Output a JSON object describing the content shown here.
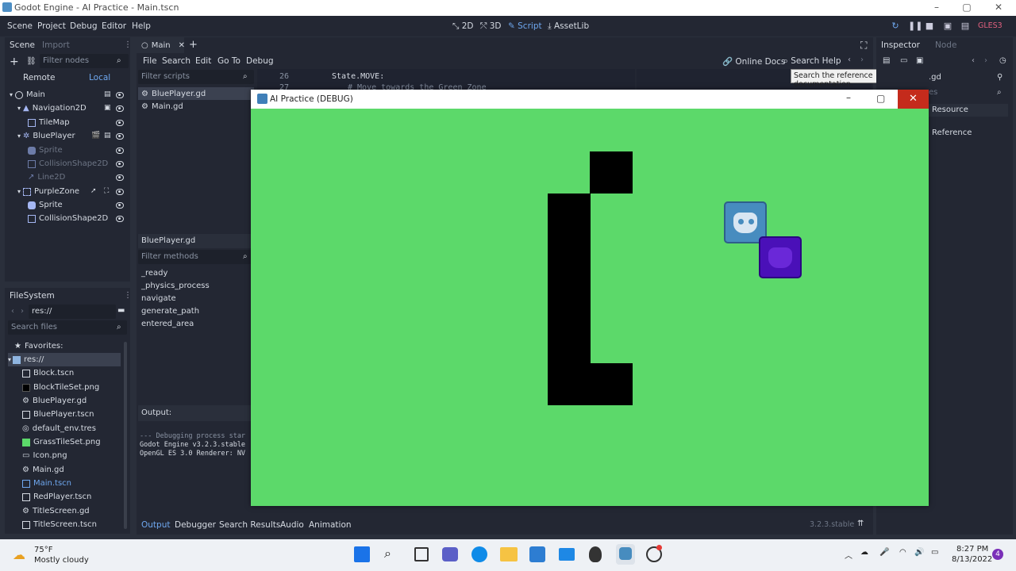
{
  "window": {
    "title": "Godot Engine - AI Practice - Main.tscn"
  },
  "menu": {
    "items": [
      "Scene",
      "Project",
      "Debug",
      "Editor",
      "Help"
    ]
  },
  "workspaces": {
    "btn2d": "2D",
    "btn3d": "3D",
    "script": "Script",
    "assetlib": "AssetLib"
  },
  "renderer": "GLES3",
  "scene_dock": {
    "tab_scene": "Scene",
    "tab_import": "Import",
    "filter_placeholder": "Filter nodes",
    "remote": "Remote",
    "local": "Local",
    "nodes": [
      "Main",
      "Navigation2D",
      "TileMap",
      "BluePlayer",
      "Sprite",
      "CollisionShape2D",
      "Line2D",
      "PurpleZone",
      "Sprite",
      "CollisionShape2D"
    ]
  },
  "filesystem": {
    "title": "FileSystem",
    "path": "res://",
    "search_placeholder": "Search files",
    "favorites": "Favorites:",
    "root": "res://",
    "files": [
      "Block.tscn",
      "BlockTileSet.png",
      "BluePlayer.gd",
      "BluePlayer.tscn",
      "default_env.tres",
      "GrassTileSet.png",
      "Icon.png",
      "Main.gd",
      "Main.tscn",
      "RedPlayer.tscn",
      "TitleScreen.gd",
      "TitleScreen.tscn"
    ]
  },
  "editor": {
    "tab": "Main",
    "menu": [
      "File",
      "Search",
      "Edit",
      "Go To",
      "Debug"
    ],
    "online_docs": "Online Docs",
    "search_help": "Search Help",
    "filter_scripts": "Filter scripts",
    "scripts": [
      "BluePlayer.gd",
      "Main.gd"
    ],
    "current_script": "BluePlayer.gd",
    "filter_methods": "Filter methods",
    "methods": [
      "_ready",
      "_physics_process",
      "navigate",
      "generate_path",
      "entered_area"
    ],
    "line_no": "26",
    "line_no2": "27",
    "code_line": "State.MOVE:",
    "code_line2": "# Move towards the Green Zone",
    "tooltip": "Search the reference documentation."
  },
  "output": {
    "title": "Output:",
    "lines": [
      "--- Debugging process star",
      "Godot Engine v3.2.3.stable",
      "OpenGL ES 3.0 Renderer: NV"
    ]
  },
  "bottom_tabs": [
    "Output",
    "Debugger",
    "Search Results",
    "Audio",
    "Animation"
  ],
  "version": "3.2.3.stable",
  "inspector": {
    "tab": "Inspector",
    "node_tab": "Node",
    "resource": "Resource",
    "reference": "Reference",
    "partial": ".gd",
    "partial2": "es"
  },
  "game_window": {
    "title": "AI Practice (DEBUG)",
    "bg": "#5cd96a"
  },
  "taskbar": {
    "temp": "75°F",
    "weather": "Mostly cloudy",
    "time": "8:27 PM",
    "date": "8/13/2022",
    "badge": "4"
  }
}
